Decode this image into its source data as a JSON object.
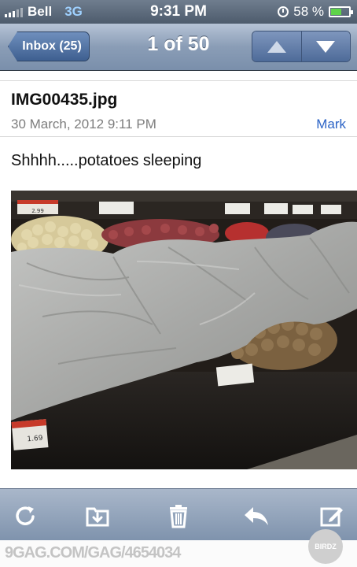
{
  "status_bar": {
    "carrier": "Bell",
    "network": "3G",
    "time": "9:31 PM",
    "battery": "58 %",
    "battery_level": 0.58,
    "icons": [
      "signal-bars-icon",
      "clock-icon",
      "battery-icon"
    ]
  },
  "nav_bar": {
    "back_label": "Inbox (25)",
    "position": "1 of 50",
    "prev_icon": "arrow-up-icon",
    "next_icon": "arrow-down-icon"
  },
  "message": {
    "subject": "IMG00435.jpg",
    "date": "30 March, 2012 9:11 PM",
    "sender": "Mark",
    "body": "Shhhh.....potatoes sleeping"
  },
  "photo": {
    "price_tags": [
      "2.99",
      "1.69",
      "1.69"
    ]
  },
  "toolbar": {
    "buttons": [
      "refresh-icon",
      "move-folder-icon",
      "trash-icon",
      "reply-icon",
      "compose-icon"
    ]
  },
  "watermark": {
    "text": "9GAG.COM/GAG/4654034",
    "logo": "BIRDZ"
  },
  "colors": {
    "accent": "#2b63c6",
    "nav_bar": "#8a9db6",
    "toolbar": "#8ea0b8",
    "sheet": "#a9aaa8"
  }
}
